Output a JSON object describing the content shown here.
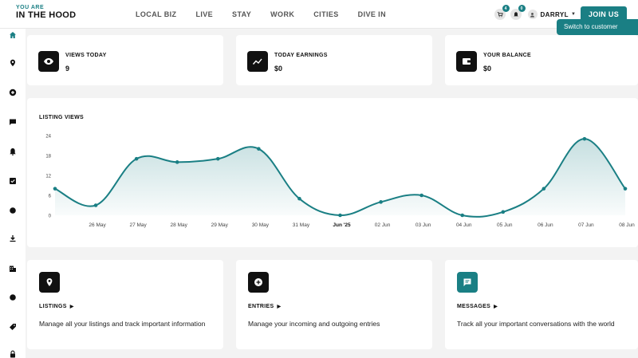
{
  "brand": {
    "small": "YOU ARE",
    "big": "IN THE HOOD",
    "accent": "#1a7f84"
  },
  "nav": {
    "items": [
      {
        "label": "LOCAL BIZ"
      },
      {
        "label": "LIVE"
      },
      {
        "label": "STAY"
      },
      {
        "label": "WORK"
      },
      {
        "label": "CITIES"
      },
      {
        "label": "DIVE IN"
      }
    ],
    "cart_count": "4",
    "notification_count": "0",
    "username": "DARRYL",
    "join_label": "JOIN US"
  },
  "sidebar": {
    "icons": [
      "home-icon",
      "location-pin-icon",
      "add-circle-icon",
      "chat-icon",
      "bell-icon",
      "checklist-icon",
      "dot-icon",
      "download-icon",
      "building-icon",
      "dot-icon",
      "tag-icon",
      "lock-icon"
    ]
  },
  "switch_label": "Switch to customer",
  "stats": [
    {
      "label": "VIEWS TODAY",
      "value": "9",
      "icon": "eye-icon"
    },
    {
      "label": "TODAY EARNINGS",
      "value": "$0",
      "icon": "trend-line-icon"
    },
    {
      "label": "YOUR BALANCE",
      "value": "$0",
      "icon": "wallet-icon"
    }
  ],
  "chart_data": {
    "type": "area",
    "title": "LISTING VIEWS",
    "categories": [
      "26 May",
      "27 May",
      "28 May",
      "29 May",
      "30 May",
      "31 May",
      "Jun '25",
      "02 Jun",
      "03 Jun",
      "04 Jun",
      "05 Jun",
      "06 Jun",
      "07 Jun",
      "08 Jun"
    ],
    "x": [
      0,
      1,
      2,
      3,
      4,
      5,
      6,
      7,
      8,
      9,
      10,
      11,
      12,
      13,
      14,
      15
    ],
    "values": [
      8,
      3,
      17,
      16,
      17,
      20,
      5,
      0,
      4,
      6,
      0,
      1,
      8,
      23,
      8
    ],
    "yticks": [
      0,
      6,
      12,
      18,
      24
    ],
    "ylim": [
      0,
      24
    ],
    "color": "#1a7f84",
    "grid": false
  },
  "features": [
    {
      "title": "LISTINGS",
      "desc": "Manage all your listings and track important information",
      "icon": "location-pin-icon",
      "teal": false
    },
    {
      "title": "ENTRIES",
      "desc": "Manage your incoming and outgoing entries",
      "icon": "add-circle-icon",
      "teal": false
    },
    {
      "title": "MESSAGES",
      "desc": "Track all your important conversations with the world",
      "icon": "chat-icon",
      "teal": true
    }
  ]
}
